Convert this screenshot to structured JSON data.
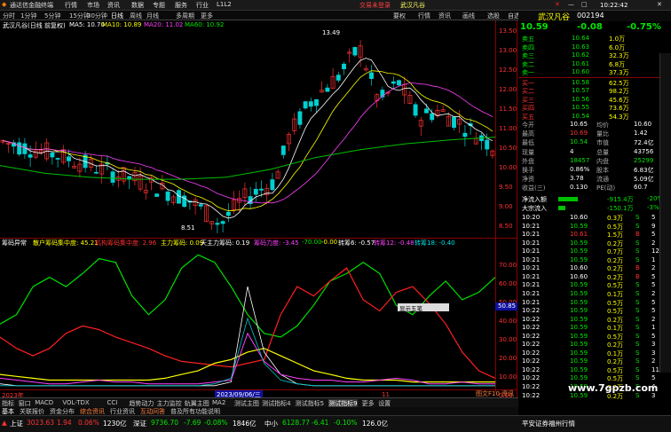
{
  "titlebar": {
    "app": "通达信金融终端",
    "menus": [
      "行情",
      "市场",
      "资讯",
      "数据",
      "专题",
      "服务",
      "行业",
      "L1L2"
    ],
    "login": "交易未登录",
    "stock": "武汉凡谷",
    "buttons": [
      "要权",
      "行情",
      "资讯",
      "画线",
      "选股",
      "自选"
    ]
  },
  "toolbar": {
    "periods": [
      "分时",
      "1分钟",
      "5分钟",
      "15分钟",
      "30分钟",
      "日线",
      "周线",
      "月线",
      "多周期",
      "更多"
    ],
    "active": "日线"
  },
  "chart": {
    "header": "武汉凡谷(日线 前复权)",
    "ma5": "MA5: 10.70",
    "ma10": "MA10: 10.89",
    "ma20": "MA20: 11.02",
    "ma60": "MA60: 10.92",
    "high_label": "13.49",
    "low_label": "8.51",
    "price_axis": [
      "13.50",
      "13.00",
      "12.50",
      "12.00",
      "11.50",
      "11.00",
      "10.50",
      "10.00",
      "9.50",
      "9.00",
      "8.50"
    ],
    "indicator_header": [
      "筹码异常",
      "散户筹码集中度: 45.21",
      "机构筹码集中度: 2.96",
      "主力筹码: 0.09",
      "天主力筹码: 0.19",
      "筹码力度: -3.45",
      "-70.00",
      "-0.00",
      "转筹6: -0.57",
      "转筹12: -0.48",
      "转筹18: -0.40"
    ],
    "ind_axis": [
      "70.00",
      "60.00",
      "50.00",
      "40.00",
      "30.00",
      "20.00",
      "10.00",
      "0.00"
    ],
    "ind_value": "50.85",
    "popup": "显示五笔",
    "date_left": "2023年",
    "date_cursor": "2023/09/06/三",
    "date_right": "11"
  },
  "chart_data": {
    "type": "line",
    "title": "武汉凡谷(日线 前复权)",
    "ylim": [
      8.3,
      13.7
    ],
    "series": [
      {
        "name": "MA60",
        "values": [
          10.2,
          10.0,
          9.9,
          9.85,
          9.85,
          9.9,
          10.1,
          10.4,
          10.6,
          10.75,
          10.85,
          10.92
        ]
      }
    ]
  },
  "tabs": [
    "指标",
    "窗口",
    "MACD",
    "VOL-TDX",
    "CCI",
    "趋势动力",
    "主力监控",
    "轨翼主图",
    "MA2",
    "测试主图",
    "测试指标4",
    "测试指标5",
    "测试指标9",
    "更多",
    "设置"
  ],
  "tabs2": [
    "基本",
    "关联报价",
    "资金分布",
    "综合资讯",
    "行业资讯",
    "互动问答",
    "普及所有功能说明"
  ],
  "quote": {
    "name": "武汉凡谷",
    "code": "002194",
    "price": "10.59",
    "change": "-0.08",
    "pct": "-0.75%",
    "asks": [
      [
        "卖五",
        "10.64",
        "1.0万"
      ],
      [
        "卖四",
        "10.63",
        "6.0万"
      ],
      [
        "卖三",
        "10.62",
        "32.3万"
      ],
      [
        "卖二",
        "10.61",
        "6.8万"
      ],
      [
        "卖一",
        "10.60",
        "37.3万"
      ]
    ],
    "bids": [
      [
        "买一",
        "10.58",
        "62.5万"
      ],
      [
        "买二",
        "10.57",
        "98.2万"
      ],
      [
        "买三",
        "10.56",
        "45.6万"
      ],
      [
        "买四",
        "10.55",
        "73.6万"
      ],
      [
        "买五",
        "10.54",
        "54.3万"
      ]
    ],
    "stats": [
      [
        "今开",
        "10.65",
        "均价",
        "10.60"
      ],
      [
        "最高",
        "10.69",
        "量比",
        "1.42"
      ],
      [
        "最低",
        "10.54",
        "市值",
        "72.4亿"
      ],
      [
        "现量",
        "4",
        "总量",
        "43756"
      ],
      [
        "外盘",
        "18457",
        "内盘",
        "25299"
      ],
      [
        "换手",
        "0.86%",
        "股本",
        "6.83亿"
      ],
      [
        "净资",
        "3.78",
        "流通",
        "5.09亿"
      ],
      [
        "收益(三)",
        "0.130",
        "PE(动)",
        "60.7"
      ]
    ],
    "flow": [
      [
        "净流入额",
        "-915.4万",
        "-20%"
      ],
      [
        "大宗流入",
        "-150.1万",
        "-3%"
      ]
    ],
    "ticks": [
      [
        "10:20",
        "10.60",
        "0.3万",
        "S",
        "5"
      ],
      [
        "10:21",
        "10.59",
        "0.5万",
        "S",
        "9"
      ],
      [
        "10:21",
        "10.61",
        "1.5万",
        "B",
        "5"
      ],
      [
        "10:21",
        "10.59",
        "0.2万",
        "S",
        "2"
      ],
      [
        "10:21",
        "10.59",
        "0.7万",
        "S",
        "12"
      ],
      [
        "10:21",
        "10.59",
        "0.2万",
        "S",
        "1"
      ],
      [
        "10:21",
        "10.60",
        "0.2万",
        "B",
        "2"
      ],
      [
        "10:21",
        "10.60",
        "0.2万",
        "B",
        "5"
      ],
      [
        "10:21",
        "10.59",
        "0.5万",
        "S",
        "5"
      ],
      [
        "10:21",
        "10.59",
        "0.1万",
        "S",
        "2"
      ],
      [
        "10:21",
        "10.59",
        "0.5万",
        "S",
        "5"
      ],
      [
        "10:22",
        "10.59",
        "0.5万",
        "S",
        "5"
      ],
      [
        "10:22",
        "10.59",
        "0.2万",
        "S",
        "2"
      ],
      [
        "10:22",
        "10.59",
        "0.1万",
        "S",
        "1"
      ],
      [
        "10:22",
        "10.59",
        "0.5万",
        "S",
        "5"
      ],
      [
        "10:22",
        "10.59",
        "0.2万",
        "S",
        "3"
      ],
      [
        "10:22",
        "10.59",
        "0.1万",
        "S",
        "3"
      ],
      [
        "10:22",
        "10.59",
        "0.2万",
        "S",
        "2"
      ],
      [
        "10:22",
        "10.59",
        "0.5万",
        "S",
        "11"
      ],
      [
        "10:22",
        "10.59",
        "0.5万",
        "S",
        "5"
      ],
      [
        "10:22",
        "10.59",
        "0.2万",
        "S",
        "4"
      ],
      [
        "10:22",
        "10.59",
        "0.2万",
        "S",
        "3"
      ]
    ],
    "time": "10:22:42",
    "f10": "图文F10 资讯"
  },
  "status": {
    "sh_label": "上证",
    "sh": "3023.63",
    "sh_ch": "1.94",
    "sh_pct": "0.06%",
    "sh_amt": "1230亿",
    "sz_label": "深证",
    "sz": "9736.70",
    "sz_ch": "-7.69",
    "sz_pct": "-0.08%",
    "sz_amt": "1846亿",
    "zx_label": "中小",
    "zx": "6128.77",
    "zx_ch": "-6.41",
    "zx_pct": "-0.10%",
    "zx_amt": "126.0亿",
    "broker": "平安证券福州行情"
  },
  "watermark": "www.7gpzb.com",
  "colors": {
    "up": "#ff3232",
    "down": "#00e600",
    "ma5": "#ffffff",
    "ma10": "#ffff00",
    "ma20": "#ff40ff",
    "ma60": "#00c000"
  }
}
